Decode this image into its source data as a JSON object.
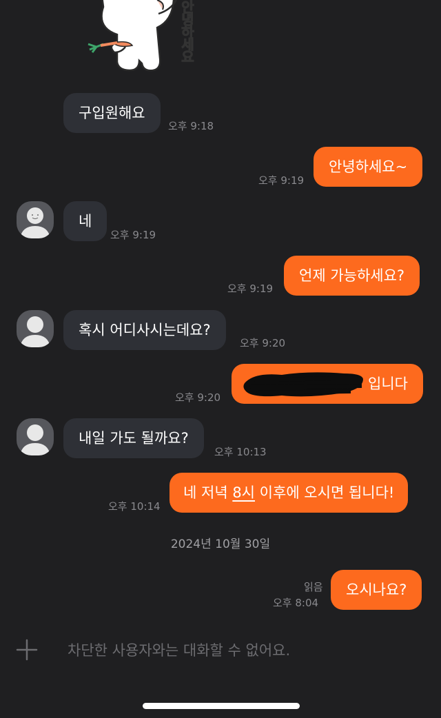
{
  "sticker": {
    "text": "안녕하세요"
  },
  "messages": [
    {
      "id": "m1",
      "side": "in",
      "text": "구입원해요",
      "time": "오후 9:18"
    },
    {
      "id": "m2",
      "side": "out",
      "text": "안녕하세요~",
      "time": "오후 9:19"
    },
    {
      "id": "m3",
      "side": "in",
      "text": "네",
      "time": "오후 9:19"
    },
    {
      "id": "m4",
      "side": "out",
      "text": "언제 가능하세요?",
      "time": "오후 9:19"
    },
    {
      "id": "m5",
      "side": "in",
      "text": "혹시 어디사시는데요?",
      "time": "오후 9:20"
    },
    {
      "id": "m6",
      "side": "out",
      "text": "입니다",
      "time": "오후 9:20"
    },
    {
      "id": "m7",
      "side": "in",
      "text": "내일 가도 될까요?",
      "time": "오후 10:13"
    },
    {
      "id": "m8",
      "side": "out",
      "text_pre": "네 저녁 ",
      "text_link": "8시",
      "text_post": " 이후에 오시면 됩니다!",
      "time": "오후 10:14"
    },
    {
      "id": "m9",
      "side": "out",
      "text": "오시나요?",
      "time": "오후 8:04",
      "read_label": "읽음"
    }
  ],
  "date_separator": "2024년 10월 30일",
  "composer": {
    "notice": "차단한 사용자와는 대화할 수 없어요.",
    "icon": "plus-icon"
  },
  "colors": {
    "background": "#1f1f21",
    "incoming_bubble": "#2e3036",
    "outgoing_bubble": "#fd6a1e",
    "timestamp": "#8a8a8e"
  }
}
